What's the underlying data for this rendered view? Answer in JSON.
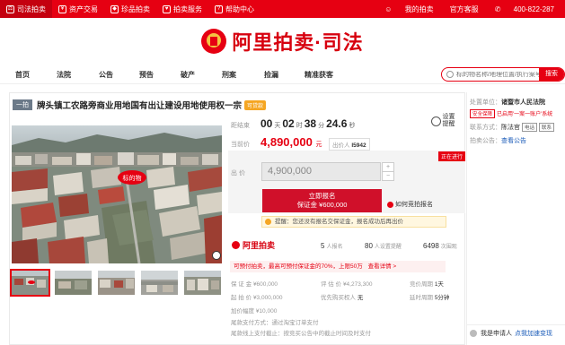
{
  "topbar": {
    "tabs": [
      {
        "label": "司法拍卖",
        "icon": "gavel-icon"
      },
      {
        "label": "资产交易",
        "icon": "asset-icon"
      },
      {
        "label": "珍品拍卖",
        "icon": "gem-icon"
      },
      {
        "label": "拍卖服务",
        "icon": "service-icon"
      },
      {
        "label": "帮助中心",
        "icon": "help-icon"
      }
    ],
    "my_auction": "我的拍卖",
    "official_account": "官方客服",
    "phone": "400-822-287"
  },
  "header": {
    "logo_text": "阿里拍卖·司法"
  },
  "nav": {
    "items": [
      "首页",
      "法院",
      "公告",
      "预告",
      "破产",
      "刑案",
      "捡漏",
      "精准获客"
    ]
  },
  "search": {
    "placeholder": "标的物名称/地理位置/执行案号",
    "button": "搜索"
  },
  "item": {
    "tag": "一拍",
    "title": "牌头镇工农路旁商业用地国有出让建设用地使用权一宗",
    "badge": "可贷款",
    "image_marker": "标的物"
  },
  "auction": {
    "countdown_label": "距结束",
    "countdown": {
      "days": "00",
      "day_unit": "天",
      "hours": "02",
      "hour_unit": "时",
      "minutes": "38",
      "minute_unit": "分",
      "seconds": "24.6",
      "second_unit": "秒"
    },
    "price_label": "当前价",
    "price": "4,890,000",
    "price_unit": "元",
    "bidder_label": "出价人",
    "bidder": "I5942",
    "remind_label": "设置提醒",
    "status": "正在进行",
    "bid_label": "出 价",
    "bid_value": "4,900,000",
    "plus": "+",
    "minus": "−",
    "signup_label": "立即报名",
    "signup_sub": "保证金 ¥600,000",
    "howto": "如何竞拍报名",
    "notice": "提醒：您还没有报名交保证金，报名成功后再出价"
  },
  "stats": {
    "brand": "阿里拍卖",
    "signup_count": "5",
    "signup_label": "人报名",
    "remind_count": "80",
    "remind_label": "人设置提醒",
    "view_count": "6498",
    "view_label": "次围观"
  },
  "loan": {
    "text": "可预付拍卖，最高可预付保证金的70%，上限50万",
    "link": "查看详情 >"
  },
  "details": {
    "deposit_label": "保 证 金",
    "deposit": "¥600,000",
    "estimate_label": "评 估 价",
    "estimate": "¥4,273,300",
    "cycle_label": "竞价周期",
    "cycle": "1天",
    "start_label": "起 拍 价",
    "start": "¥3,000,000",
    "priority_label": "优先购买权人",
    "priority": "无",
    "delay_label": "延时周期",
    "delay": "5分钟",
    "increment_label": "加价幅度",
    "increment": "¥10,000",
    "method_label": "尾款支付方式：",
    "method": "通过淘宝订单支付",
    "deadline_label": "尾款线上支付截止：",
    "deadline": "按竞买公告中的截止时间及时支付"
  },
  "court": {
    "disposer_label": "处置单位：",
    "disposer": "诸暨市人民法院",
    "badges": [
      "安全保障",
      "已启用'一案一账户'系统"
    ],
    "contact_label": "联系方式：",
    "contact_name": "陈法官",
    "contact_badges": [
      "电话",
      "联系"
    ],
    "notice_label": "拍卖公告：",
    "notice_link": "查看公告"
  },
  "assistant": {
    "text": "我是申请人",
    "link": "点我加速变现"
  }
}
